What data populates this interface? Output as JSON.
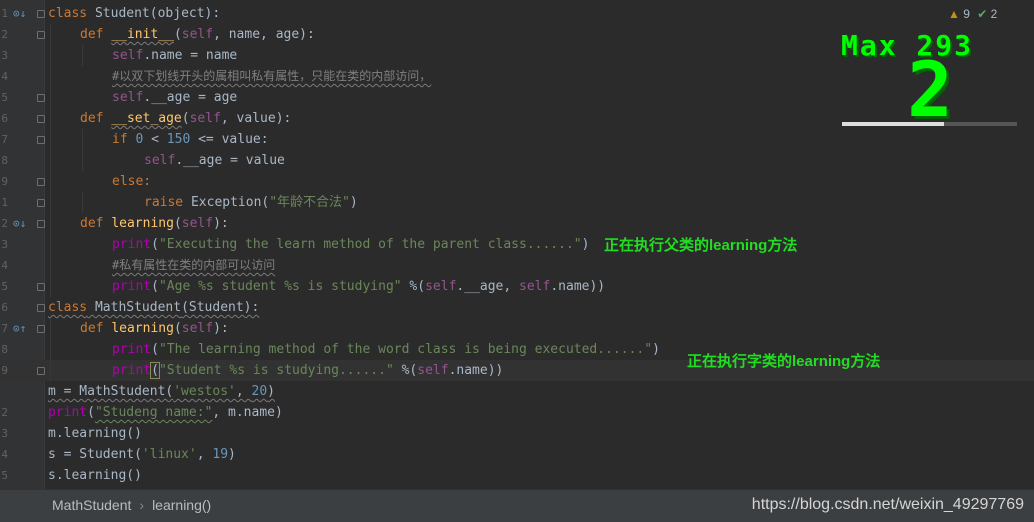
{
  "editor": {
    "line_numbers": [
      "1",
      "2",
      "3",
      "4",
      "5",
      "6",
      "7",
      "8",
      "9",
      "1",
      "2",
      "3",
      "4",
      "5",
      "6",
      "7",
      "8",
      "9",
      "",
      "2",
      "3",
      "4",
      "5"
    ],
    "lines": {
      "l1": {
        "kw": "class",
        "name": " Student",
        "rest": "(object):"
      },
      "l2": {
        "kw": "def",
        "name": "__init__",
        "p1": "(",
        "self": "self",
        "rest": ", name, age):"
      },
      "l3": {
        "self": "self",
        "rest": ".name = name"
      },
      "l4": {
        "comment": "#以双下划线开头的属相叫私有属性，只能在类的内部访问，"
      },
      "l5": {
        "self": "self",
        "rest": ".__age = age"
      },
      "l6": {
        "kw": "def",
        "name": "__set_age",
        "p1": "(",
        "self": "self",
        "rest": ", value):"
      },
      "l7": {
        "kw": "if",
        "num1": "0",
        "mid": " < ",
        "num2": "150",
        "rest": " <= value:"
      },
      "l8": {
        "self": "self",
        "rest": ".__age = value"
      },
      "l9": {
        "kw": "else:"
      },
      "l10": {
        "kw": "raise",
        "mid": " Exception(",
        "str": "\"年龄不合法\"",
        "rest": ")"
      },
      "l11": {
        "kw": "def",
        "name": "learning",
        "p1": "(",
        "self": "self",
        "rest": "):"
      },
      "l12": {
        "fn": "print",
        "p1": "(",
        "str": "\"Executing the learn method of the parent class......\"",
        "rest": ")"
      },
      "l13": {
        "comment": "#私有属性在类的内部可以访问"
      },
      "l14": {
        "fn": "print",
        "p1": "(",
        "str": "\"Age %s student %s is studying\"",
        "mid": " %(",
        "self1": "self",
        "mid2": ".__age, ",
        "self2": "self",
        "rest": ".name))"
      },
      "l15": {
        "kw": "class",
        "name": " MathStudent",
        "rest": "(Student):"
      },
      "l16": {
        "kw": "def",
        "name": "learning",
        "p1": "(",
        "self": "self",
        "rest": "):"
      },
      "l17": {
        "fn": "print",
        "p1": "(",
        "str": "\"The learning method of the word class is being executed......\"",
        "rest": ")"
      },
      "l18": {
        "fn": "print",
        "p1": "(",
        "str": "\"Student %s is studying......\"",
        "mid": " %(",
        "self": "self",
        "rest": ".name))"
      },
      "l19": {
        "pre": "m = MathStudent(",
        "str": "'westos'",
        "mid": ", ",
        "num": "20",
        "rest": ")"
      },
      "l20": {
        "fn": "print",
        "p1": "(",
        "str": "\"Studeng name:\"",
        "rest": ", m.name)"
      },
      "l21": {
        "text": "m.learning()"
      },
      "l22": {
        "pre": "s = Student(",
        "str": "'linux'",
        "mid": ", ",
        "num": "19",
        "rest": ")"
      },
      "l23": {
        "text": "s.learning()"
      }
    }
  },
  "annotations": {
    "parent_note": "正在执行父类的learning方法",
    "child_note": "正在执行字类的learning方法"
  },
  "inspections": {
    "warnings_icon": "warning-triangle-icon",
    "warnings": "9",
    "ok_icon": "check-icon",
    "ok": "2"
  },
  "overlay": {
    "title": "Max 293",
    "big": "2",
    "progress": 0.58
  },
  "statusbar": {
    "crumb1": "MathStudent",
    "crumb_sep": "›",
    "crumb2": "learning()",
    "watermark": "https://blog.csdn.net/weixin_49297769"
  },
  "colors": {
    "background": "#2b2b2b",
    "keyword": "#cc7832",
    "function": "#ffc66d",
    "self": "#94558d",
    "string": "#6a8759",
    "number": "#6897bb",
    "comment": "#808080",
    "annotation": "#22dd22",
    "overlay_green": "#00ff00"
  }
}
